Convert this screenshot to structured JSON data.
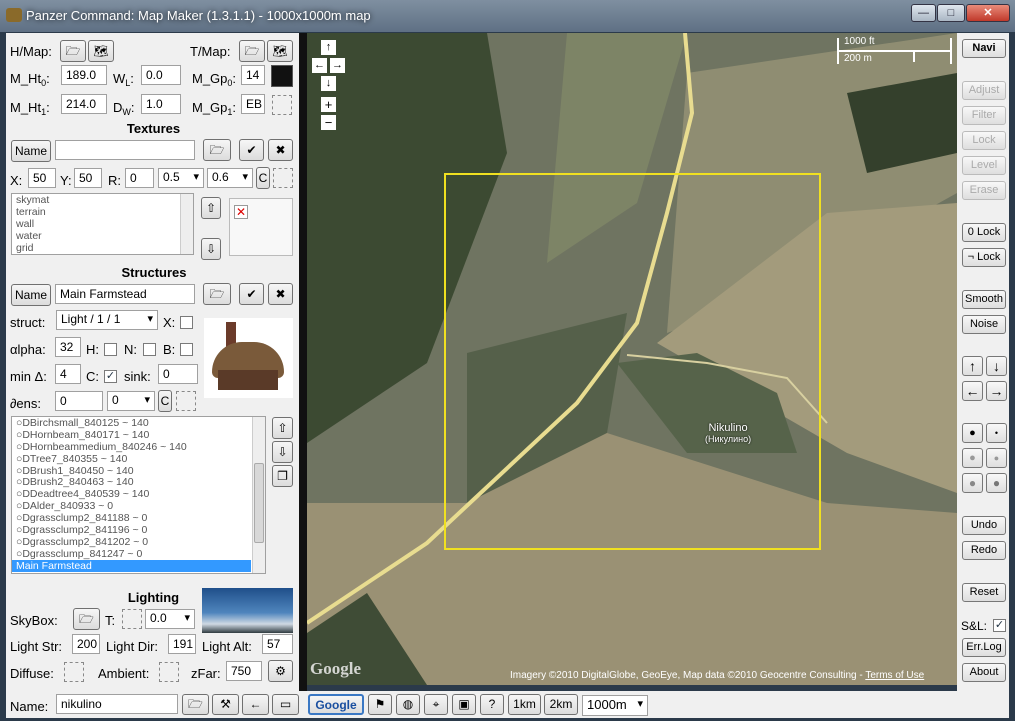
{
  "window": {
    "title": "Panzer Command: Map Maker (1.3.1.1) - 1000x1000m map",
    "min": "—",
    "max": "□",
    "close": "✕"
  },
  "heightmap": {
    "hmap_label": "H/Map:",
    "tmap_label": "T/Map:",
    "mht0_label": "M_Ht",
    "mht0_sub": "0",
    "mht0_suffix": ":",
    "mht0_value": "189.0",
    "wl_label": "W",
    "wl_sub": "L",
    "wl_suffix": ":",
    "wl_value": "0.0",
    "mgp0_label": "M_Gp",
    "mgp0_sub": "0",
    "mgp0_suffix": ":",
    "mgp0_value": "14",
    "mht1_label": "M_Ht",
    "mht1_sub": "1",
    "mht1_suffix": ":",
    "mht1_value": "214.0",
    "dw_label": "D",
    "dw_sub": "W",
    "dw_suffix": ":",
    "dw_value": "1.0",
    "mgp1_label": "M_Gp",
    "mgp1_sub": "1",
    "mgp1_suffix": ":",
    "mgp1_value": "EB"
  },
  "textures": {
    "header": "Textures",
    "name_button": "Name",
    "name_value": "",
    "x_label": "X:",
    "x_value": "50",
    "y_label": "Y:",
    "y_value": "50",
    "r_label": "R:",
    "r_value": "0",
    "sel1": "0.5",
    "sel2": "0.6",
    "c_button": "C",
    "items": [
      "skymat",
      "terrain",
      "wall",
      "water",
      "grid"
    ]
  },
  "structures": {
    "header": "Structures",
    "name_button": "Name",
    "name_value": "Main Farmstead",
    "struct_label": "struct:",
    "struct_value": "Light / 1 / 1",
    "x_label": "X:",
    "alpha_label": "αlpha:",
    "alpha_value": "32",
    "h_label": "H:",
    "n_label": "N:",
    "b_label": "B:",
    "mindelta_label": "min Δ:",
    "mindelta_value": "4",
    "c_label": "C:",
    "c_checked": "✓",
    "sink_label": "sink:",
    "sink_value": "0",
    "dens_label": "∂ens:",
    "dens_value": "0",
    "dens_sel": "0",
    "c_button": "C",
    "items": [
      "○DBirchsmall_840125 ~ 140",
      "○DHornbeam_840171 ~ 140",
      "○DHornbeammedium_840246 ~ 140",
      "○DTree7_840355 ~ 140",
      "○DBrush1_840450 ~ 140",
      "○DBrush2_840463 ~ 140",
      "○DDeadtree4_840539 ~ 140",
      "○DAlder_840933 ~ 0",
      "○Dgrassclump2_841188 ~ 0",
      "○Dgrassclump2_841196 ~ 0",
      "○Dgrassclump2_841202 ~ 0",
      "○Dgrassclump_841247 ~ 0",
      "Main Farmstead"
    ]
  },
  "lighting": {
    "header": "Lighting",
    "skybox_label": "SkyBox:",
    "t_label": "T:",
    "t_value": "0.0",
    "lightstr_label": "Light Str:",
    "lightstr_value": "200",
    "lightdir_label": "Light Dir:",
    "lightdir_value": "191",
    "lightalt_label": "Light Alt:",
    "lightalt_value": "57",
    "diffuse_label": "Diffuse:",
    "ambient_label": "Ambient:",
    "zfar_label": "zFar:",
    "zfar_value": "750"
  },
  "bottom": {
    "name_label": "Name:",
    "name_value": "nikulino",
    "google": "Google",
    "help": "?",
    "b1km": "1km",
    "b2km": "2km",
    "range": "1000m"
  },
  "map": {
    "scale_ft": "1000 ft",
    "scale_m": "200 m",
    "place_name": "Nikulino",
    "place_name_ru": "(Никулино)",
    "attribution": "Imagery ©2010 DigitalGlobe, GeoEye, Map data ©2010 Geocentre Consulting - ",
    "terms": "Terms of Use",
    "logo": "Google",
    "zoom_in": "+",
    "zoom_out": "−",
    "selection_color": "#f0e020"
  },
  "right": {
    "navi": "Navi",
    "adjust": "Adjust",
    "filter": "Filter",
    "lock": "Lock",
    "level": "Level",
    "erase": "Erase",
    "zero_lock": "0 Lock",
    "neg_lock": "¬ Lock",
    "smooth": "Smooth",
    "noise": "Noise",
    "undo": "Undo",
    "redo": "Redo",
    "reset": "Reset",
    "sl_label": "S&L:",
    "sl_checked": "✓",
    "errlog": "Err.Log",
    "about": "About"
  }
}
